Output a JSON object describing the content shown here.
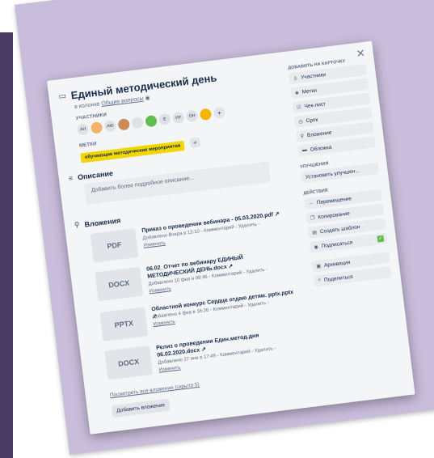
{
  "card": {
    "title": "Единый методический день",
    "in_list_prefix": "в колонке",
    "list_name": "Общие вопросы",
    "members_label": "УЧАСТНИКИ",
    "members": [
      "АН",
      "",
      "АЮ",
      "",
      "",
      "",
      "Е",
      "ИУ",
      "ОН",
      ""
    ],
    "labels_label": "МЕТКИ",
    "label_text": "обучающие методические мероприятия",
    "description_label": "Описание",
    "description_placeholder": "Добавить более подробное описание...",
    "attachments_label": "Вложения",
    "attachments": [
      {
        "type": "PDF",
        "name": "Приказ о проведении вебинара - 05.03.2020.pdf ↗",
        "meta": "Добавлено Вчера в 13:10 - Комментарий - Удалить -",
        "edit": "Изменить"
      },
      {
        "type": "DOCX",
        "name": "06.02_Отчет по вебинару ЕДИНЫЙ МЕТОДИЧЕСКИЙ ДЕНЬ.docx ↗",
        "meta": "Добавлено 10 фев в 08:46 - Комментарий - Удалить -",
        "edit": "Изменить"
      },
      {
        "type": "PPTX",
        "name": "Областной конкурс Сердце отдаю детям. pptx.pptx ↗",
        "meta": "Добавлено 4 фев в 16:26 - Комментарий - Удалить -",
        "edit": "Изменить"
      },
      {
        "type": "DOCX",
        "name": "Релиз о проведении Един.метод.дня 06.02.2020.docx ↗",
        "meta": "Добавлено 27 янв в 17:49 - Комментарий - Удалить -",
        "edit": "Изменить"
      }
    ],
    "show_all": "Посмотреть все вложения (скрыто 5)",
    "add_attachment": "Добавить вложение"
  },
  "sidebar": {
    "add_label": "ДОБАВИТЬ НА КАРТОЧКУ",
    "add_items": [
      "Участники",
      "Метки",
      "Чек-лист",
      "Срок",
      "Вложение",
      "Обложка"
    ],
    "improvements_label": "УЛУЧШЕНИЯ",
    "improvements_button": "Установить улучшен...",
    "actions_label": "ДЕЙСТВИЯ",
    "actions": [
      "Перемещение",
      "Копирование",
      "Создать шаблон",
      "Подписаться"
    ],
    "actions2": [
      "Архивация",
      "Поделиться"
    ]
  },
  "icons": {
    "close": "close-icon"
  }
}
